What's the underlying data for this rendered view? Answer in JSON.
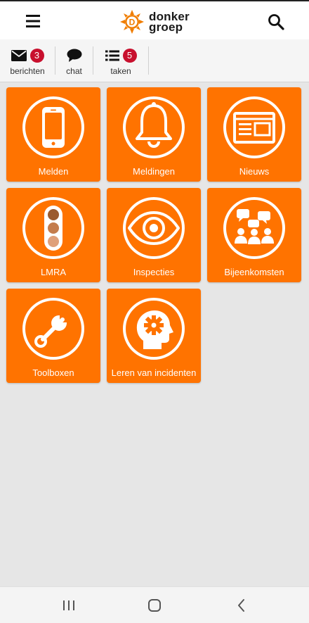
{
  "header": {
    "logo_line1": "donker",
    "logo_line2": "groep",
    "logo_letter": "D"
  },
  "toolbar": {
    "items": [
      {
        "label": "berichten",
        "icon": "envelope-icon",
        "badge": "3"
      },
      {
        "label": "chat",
        "icon": "speech-bubble-icon"
      },
      {
        "label": "taken",
        "icon": "list-icon",
        "badge": "5"
      }
    ]
  },
  "tiles": [
    {
      "label": "Melden",
      "icon": "smartphone-icon"
    },
    {
      "label": "Meldingen",
      "icon": "bell-icon"
    },
    {
      "label": "Nieuws",
      "icon": "newspaper-icon"
    },
    {
      "label": "LMRA",
      "icon": "traffic-light-icon"
    },
    {
      "label": "Inspecties",
      "icon": "eye-icon"
    },
    {
      "label": "Bijeenkomsten",
      "icon": "meeting-icon"
    },
    {
      "label": "Toolboxen",
      "icon": "wrench-icon"
    },
    {
      "label": "Leren van incidenten",
      "icon": "head-gear-icon"
    }
  ],
  "colors": {
    "tile": "#ff7300",
    "badge": "#c8102e",
    "brand": "#f07d00",
    "background": "#e6e6e6"
  }
}
